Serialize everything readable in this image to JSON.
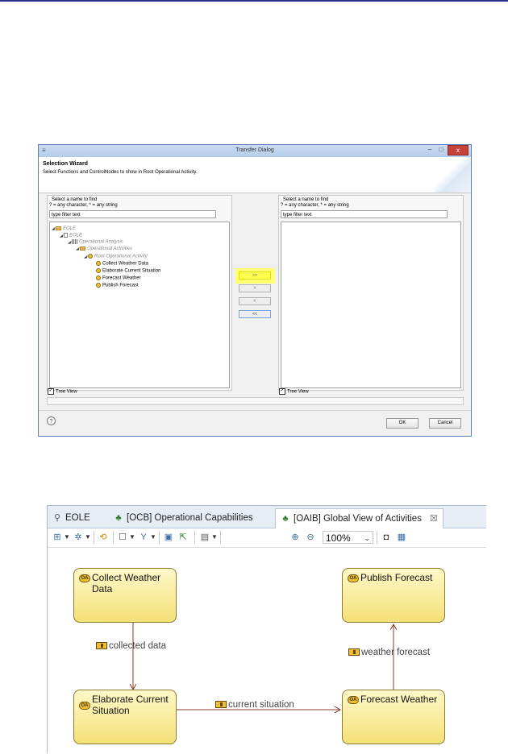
{
  "dialog": {
    "title": "Transfer Dialog",
    "minimize": "–",
    "maximize": "□",
    "close": "x",
    "wizard_title": "Selection Wizard",
    "wizard_description": "Select Functions and ControlNodes to show in Root Operational Activity.",
    "left_panel": {
      "find_label": "Select a name to find",
      "wildcard_hint": "? = any character, * = any string",
      "filter_value": "type filter text",
      "tree": [
        {
          "label": "EOLE",
          "level": 0,
          "icon": "project-folder-icon",
          "gray": true
        },
        {
          "label": "EOLE",
          "level": 1,
          "icon": "model-file-icon",
          "gray": true
        },
        {
          "label": "Operational Analysis",
          "level": 2,
          "icon": "grid-icon",
          "gray": true
        },
        {
          "label": "Operational Activities",
          "level": 3,
          "icon": "package-folder-icon",
          "gray": true
        },
        {
          "label": "Root Operational Activity",
          "level": 4,
          "icon": "operational-activity-icon",
          "gray": true
        },
        {
          "label": "Collect Weather Data",
          "level": 5,
          "icon": "operational-activity-icon",
          "gray": false
        },
        {
          "label": "Elaborate Current Situation",
          "level": 5,
          "icon": "operational-activity-icon",
          "gray": false
        },
        {
          "label": "Forecast Weather",
          "level": 5,
          "icon": "operational-activity-icon",
          "gray": false
        },
        {
          "label": "Publish Forecast",
          "level": 5,
          "icon": "operational-activity-icon",
          "gray": false
        }
      ],
      "tree_view_label": "Tree View"
    },
    "right_panel": {
      "find_label": "Select a name to find",
      "wildcard_hint": "? = any character, * = any string",
      "filter_value": "type filter text",
      "tree_view_label": "Tree View"
    },
    "move_buttons": {
      "add_all": ">>",
      "add": ">",
      "remove": "<",
      "remove_all": "<<"
    },
    "help_icon": "?",
    "ok_label": "OK",
    "cancel_label": "Cancel"
  },
  "editor": {
    "tabs": [
      {
        "label": "EOLE",
        "icon": "eole-icon"
      },
      {
        "label": "[OCB] Operational Capabilities",
        "icon": "diagram-icon"
      },
      {
        "label": "[OAIB] Global View of Activities",
        "icon": "diagram-icon",
        "active": true
      }
    ],
    "tab_close": "☒",
    "zoom_value": "100%",
    "activity_badge": "OA",
    "activities": {
      "collect": "Collect Weather Data",
      "publish": "Publish Forecast",
      "elaborate": "Elaborate Current Situation",
      "forecast": "Forecast Weather"
    },
    "flows": {
      "collected": "collected data",
      "current": "current situation",
      "weather": "weather forecast"
    }
  }
}
